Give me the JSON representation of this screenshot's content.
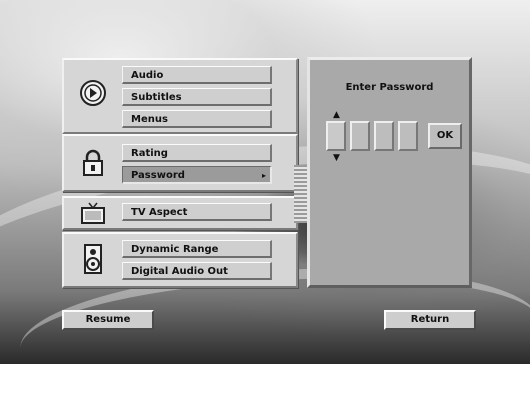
{
  "menu": {
    "groups": [
      {
        "name": "language",
        "icon": "speaker-arrow-icon",
        "items": [
          {
            "label": "Audio"
          },
          {
            "label": "Subtitles"
          },
          {
            "label": "Menus"
          }
        ]
      },
      {
        "name": "parental",
        "icon": "lock-icon",
        "items": [
          {
            "label": "Rating"
          },
          {
            "label": "Password",
            "selected": true
          }
        ]
      },
      {
        "name": "display",
        "icon": "tv-icon",
        "items": [
          {
            "label": "TV Aspect"
          }
        ]
      },
      {
        "name": "audio",
        "icon": "speaker-icon",
        "items": [
          {
            "label": "Dynamic Range"
          },
          {
            "label": "Digital Audio Out"
          }
        ]
      }
    ]
  },
  "password_panel": {
    "title": "Enter Password",
    "ok_label": "OK",
    "digit_count": 4
  },
  "buttons": {
    "resume": "Resume",
    "return": "Return"
  }
}
